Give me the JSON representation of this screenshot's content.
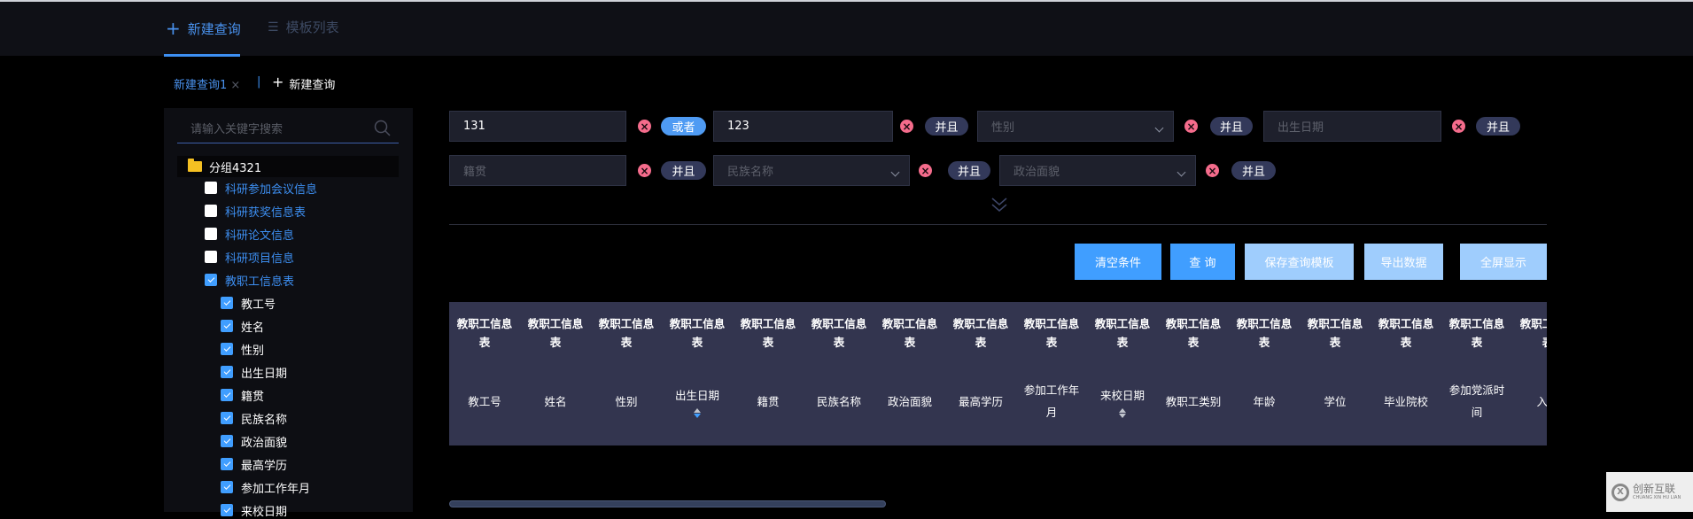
{
  "top_tabs": [
    {
      "label": "新建查询",
      "icon": "plus-icon",
      "active": true
    },
    {
      "label": "模板列表",
      "icon": "list-icon",
      "active": false
    }
  ],
  "sub_tabs": {
    "open": "新建查询1",
    "close": "×",
    "separator": "|",
    "new_label": "新建查询",
    "new_icon": "+"
  },
  "sidebar": {
    "search_placeholder": "请输入关键字搜索",
    "group": "分组4321",
    "tables": [
      {
        "label": "科研参加会议信息",
        "checked": false
      },
      {
        "label": "科研获奖信息表",
        "checked": false
      },
      {
        "label": "科研论文信息",
        "checked": false
      },
      {
        "label": "科研项目信息",
        "checked": false
      },
      {
        "label": "教职工信息表",
        "checked": true
      }
    ],
    "fields": [
      "教工号",
      "姓名",
      "性别",
      "出生日期",
      "籍贯",
      "民族名称",
      "政治面貌",
      "最高学历",
      "参加工作年月",
      "来校日期"
    ]
  },
  "filters": {
    "row1": [
      {
        "value": "131",
        "type": "text"
      },
      {
        "value": "123",
        "type": "text"
      },
      {
        "placeholder": "性别",
        "type": "select"
      },
      {
        "placeholder": "出生日期",
        "type": "text"
      }
    ],
    "row2": [
      {
        "placeholder": "籍贯",
        "type": "text"
      },
      {
        "placeholder": "民族名称",
        "type": "select"
      },
      {
        "placeholder": "政治面貌",
        "type": "select"
      }
    ],
    "connectors": [
      "或者",
      "并且",
      "并且",
      "并且",
      "并且",
      "并且",
      "并且"
    ],
    "remove_icon": "×",
    "expand_icon": "double-chevron-down"
  },
  "buttons": {
    "clear": "清空条件",
    "query": "查 询",
    "save_template": "保存查询模板",
    "export": "导出数据",
    "fullscreen": "全屏显示"
  },
  "table": {
    "group_header": "教职工信息表",
    "columns": [
      "教工号",
      "姓名",
      "性别",
      "出生日期",
      "籍贯",
      "民族名称",
      "政治面貌",
      "最高学历",
      "参加工作年月",
      "来校日期",
      "教职工类别",
      "年龄",
      "学位",
      "毕业院校",
      "参加党派时间",
      "入学"
    ],
    "sortable": [
      "出生日期",
      "来校日期"
    ]
  },
  "watermark": {
    "name": "创新互联",
    "sub": "CHUANG XIN HU LIAN"
  },
  "colors": {
    "accent": "#409eff",
    "danger": "#f56c8c",
    "header_bg": "#33354f"
  }
}
